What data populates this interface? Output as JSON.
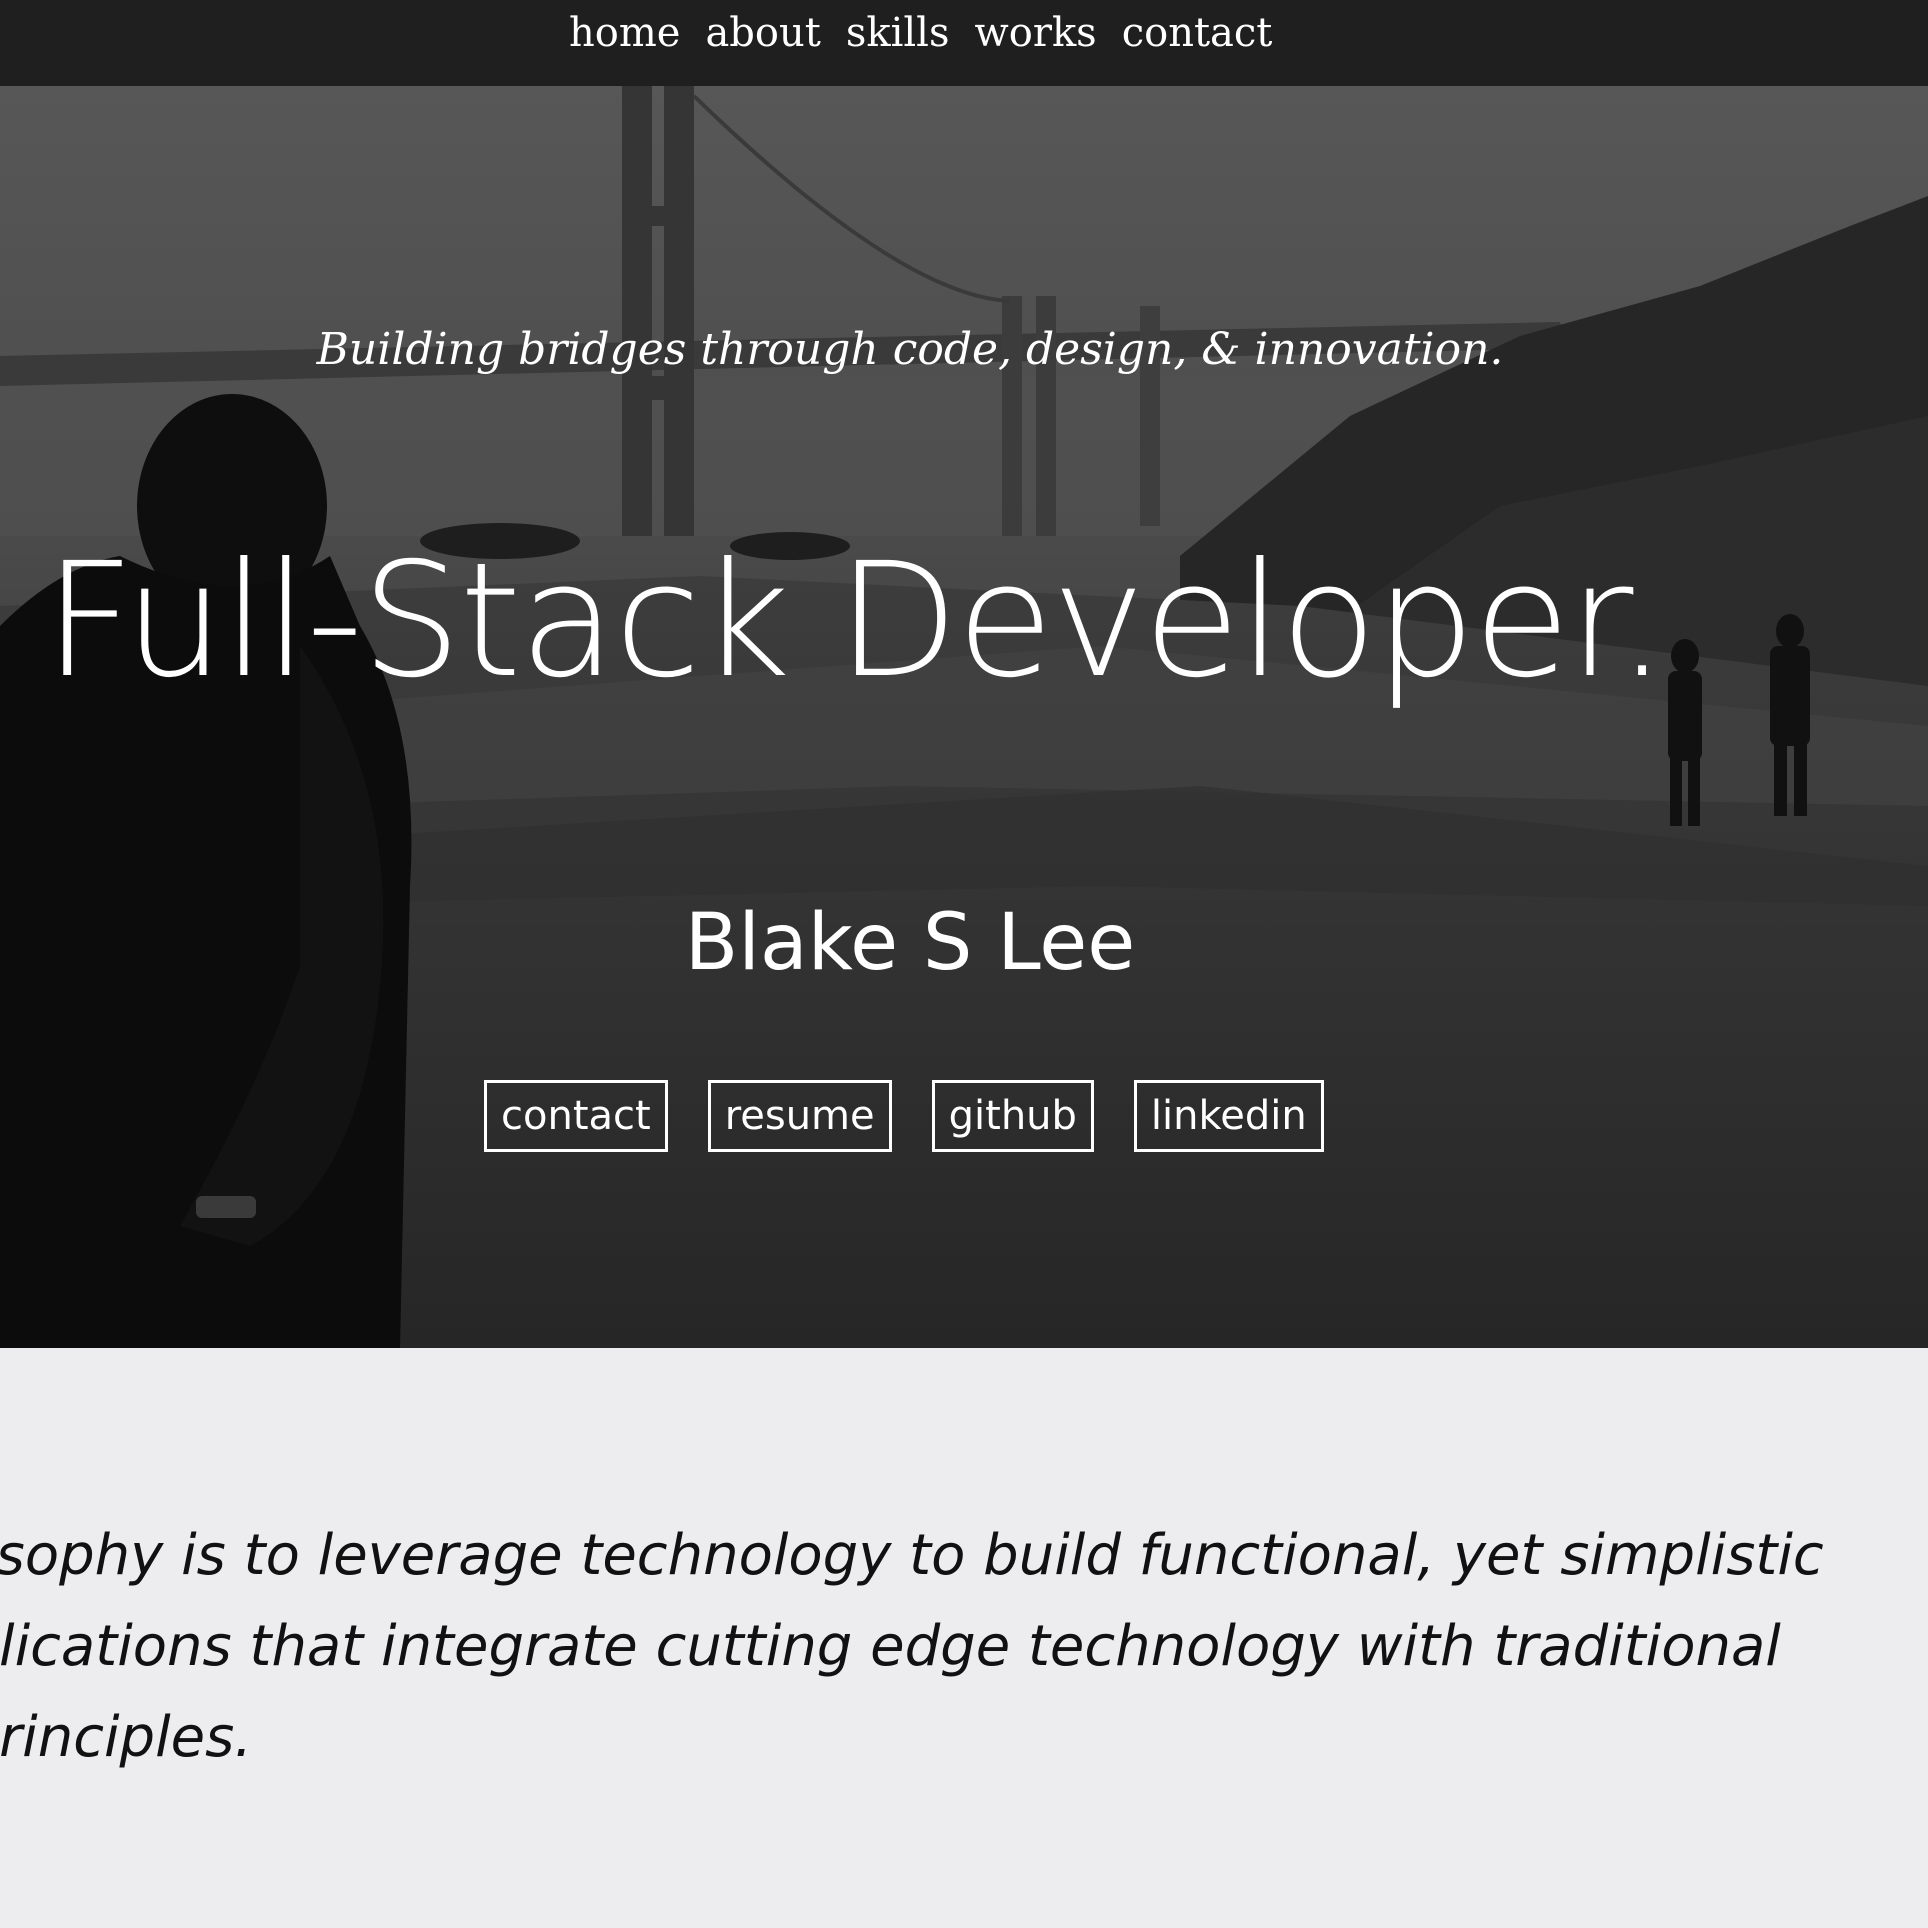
{
  "nav": {
    "items": [
      {
        "label": "home"
      },
      {
        "label": "about"
      },
      {
        "label": "skills"
      },
      {
        "label": "works"
      },
      {
        "label": "contact"
      }
    ]
  },
  "hero": {
    "tagline": "Building bridges through code, design, & innovation.",
    "headline": "Full-Stack Developer.",
    "name": "Blake S Lee",
    "buttons": [
      {
        "label": "contact"
      },
      {
        "label": "resume"
      },
      {
        "label": "github"
      },
      {
        "label": "linkedin"
      }
    ]
  },
  "philosophy": {
    "lines": [
      "My philosophy is to leverage technology to build functional, yet simplistic",
      "web applications that integrate cutting edge technology with traditional",
      "design principles."
    ]
  },
  "colors": {
    "navbar_bg": "#1f1f1f",
    "hero_overlay": "#2e2e2e",
    "section_bg": "#ededef",
    "text_light": "#ffffff",
    "text_dark": "#111111"
  }
}
